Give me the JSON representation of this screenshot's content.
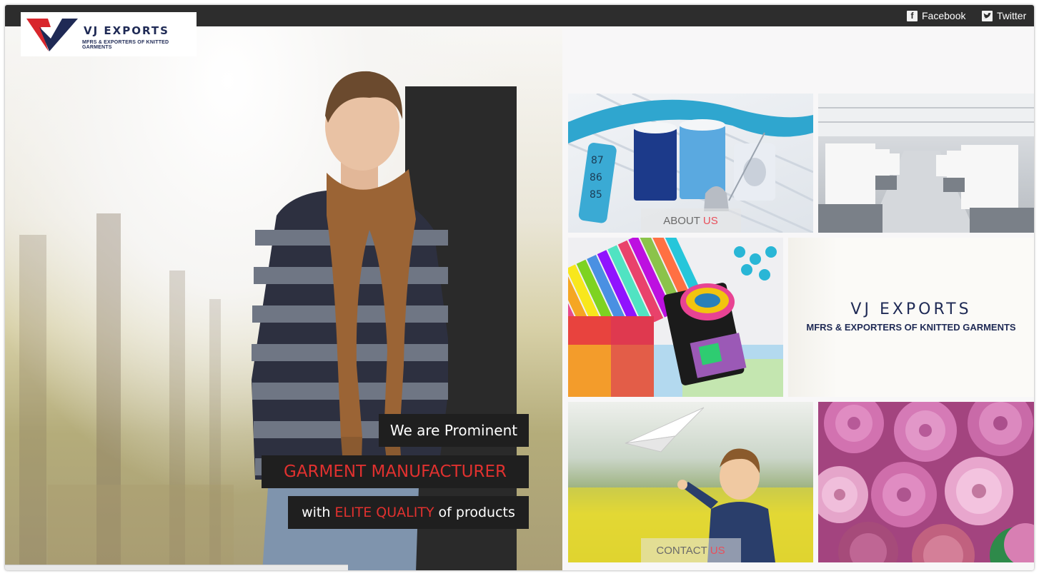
{
  "brand": {
    "name": "VJ EXPORTS",
    "tagline": "MFRS & EXPORTERS OF KNITTED GARMENTS"
  },
  "social": {
    "facebook": "Facebook",
    "twitter": "Twitter"
  },
  "hero": {
    "line1": "We are Prominent",
    "line2": "GARMENT MANUFACTURER",
    "line3_pre": "with",
    "line3_highlight": "ELITE QUALITY",
    "line3_post": "of products"
  },
  "tiles": {
    "about": {
      "label": "ABOUT",
      "highlight": "US"
    },
    "contact": {
      "label": "CONTACT",
      "highlight": "US"
    },
    "brand": {
      "name": "VJ EXPORTS",
      "tagline": "MFRS & EXPORTERS OF KNITTED GARMENTS"
    }
  },
  "colors": {
    "accent_red": "#e0312f",
    "brand_navy": "#1f2a55",
    "topbar": "#2d2d2d"
  }
}
